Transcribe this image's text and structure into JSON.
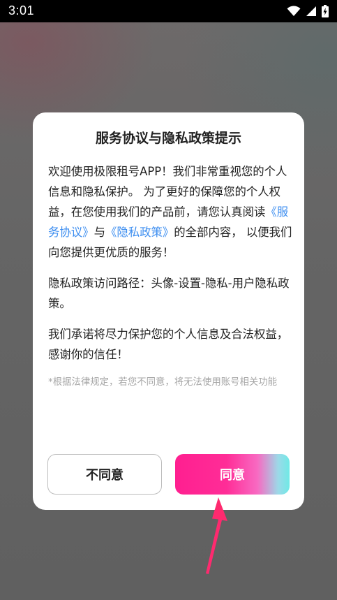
{
  "status_bar": {
    "time": "3:01",
    "icons": [
      "wifi-icon",
      "cellular-signal-icon",
      "battery-charging-icon"
    ]
  },
  "dialog": {
    "title": "服务协议与隐私政策提示",
    "intro_part1": "欢迎使用极限租号APP！我们非常重视您的个人信息和隐私保护。 为了更好的保障您的个人权益，在您使用我们的产品前，请您认真阅读",
    "service_link": "《服务协议》",
    "intro_and": "与",
    "privacy_link": "《隐私政策》",
    "intro_part2": "的全部内容， 以便我们向您提供更优质的服务！",
    "path_text": "隐私政策访问路径：头像-设置-隐私-用户隐私政策。",
    "promise_text": "我们承诺将尽力保护您的个人信息及合法权益，感谢你的信任！",
    "note_text": "*根据法律规定，若您不同意，将无法使用账号相关功能",
    "disagree_label": "不同意",
    "agree_label": "同意"
  },
  "colors": {
    "link": "#3d8ef0",
    "agree_gradient_start": "#ff1f90",
    "agree_gradient_end": "#6fe9e6",
    "arrow": "#ff2a6f",
    "note": "#a6a6a6"
  }
}
